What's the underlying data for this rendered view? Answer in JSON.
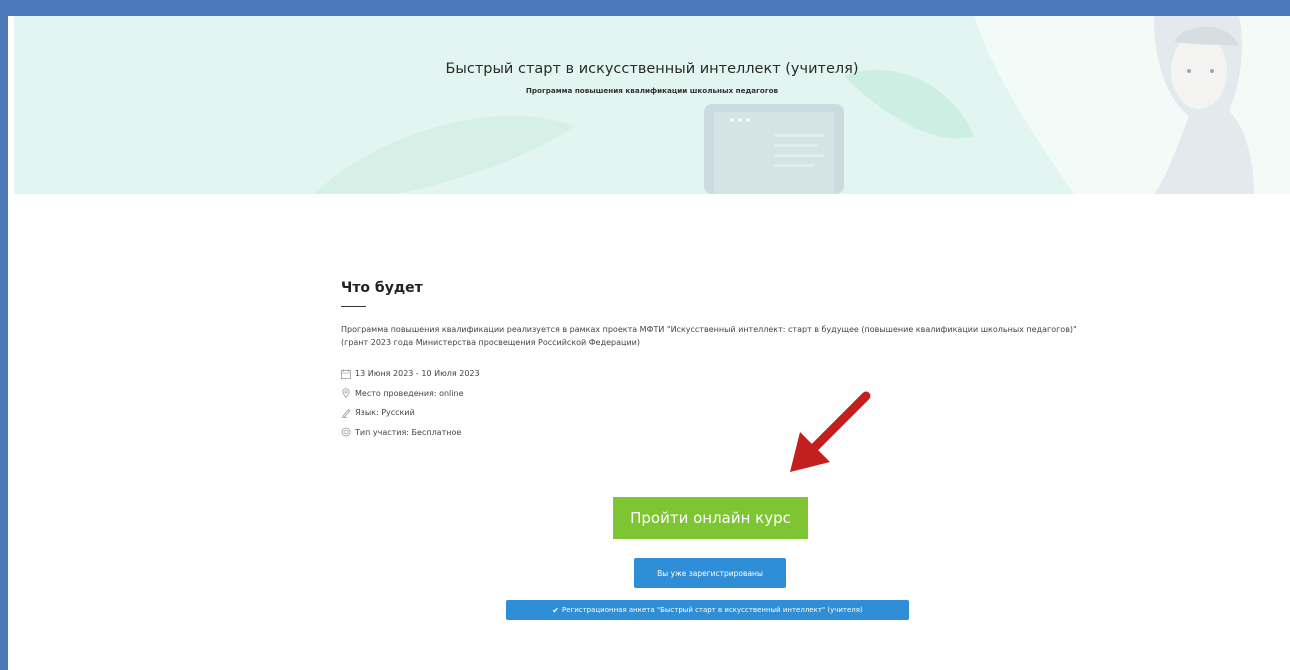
{
  "banner": {
    "title": "Быстрый старт в искусственный интеллект (учителя)",
    "subtitle": "Программа повышения квалификации школьных педагогов"
  },
  "section": {
    "title": "Что будет",
    "description": "Программа повышения квалификации реализуется в рамках проекта МФТИ \"Искусственный интеллект: старт в будущее (повышение квалификации школьных педагогов)\" (грант 2023 года Министерства просвещения Российской Федерации)"
  },
  "meta": {
    "dates": "13 Июня 2023 - 10 Июля 2023",
    "location": "Место проведения: online",
    "language": "Язык: Русский",
    "participation": "Тип участия: Бесплатное"
  },
  "actions": {
    "primary_label": "Пройти онлайн курс",
    "registered_label": "Вы уже зарегистрированы",
    "form_label": "Регистрационная анкета \"Быстрый старт в искусственный интеллект\" (учителя)"
  },
  "icons": {
    "dates": "calendar-icon",
    "location": "location-pin-icon",
    "language": "pen-icon",
    "participation": "badge-icon",
    "form": "checkmark-icon"
  },
  "colors": {
    "frame": "#4a78b8",
    "banner_bg": "#e3f5f0",
    "primary_button": "#7ec534",
    "secondary_button": "#2f8ed6",
    "arrow": "#c41f1f"
  }
}
